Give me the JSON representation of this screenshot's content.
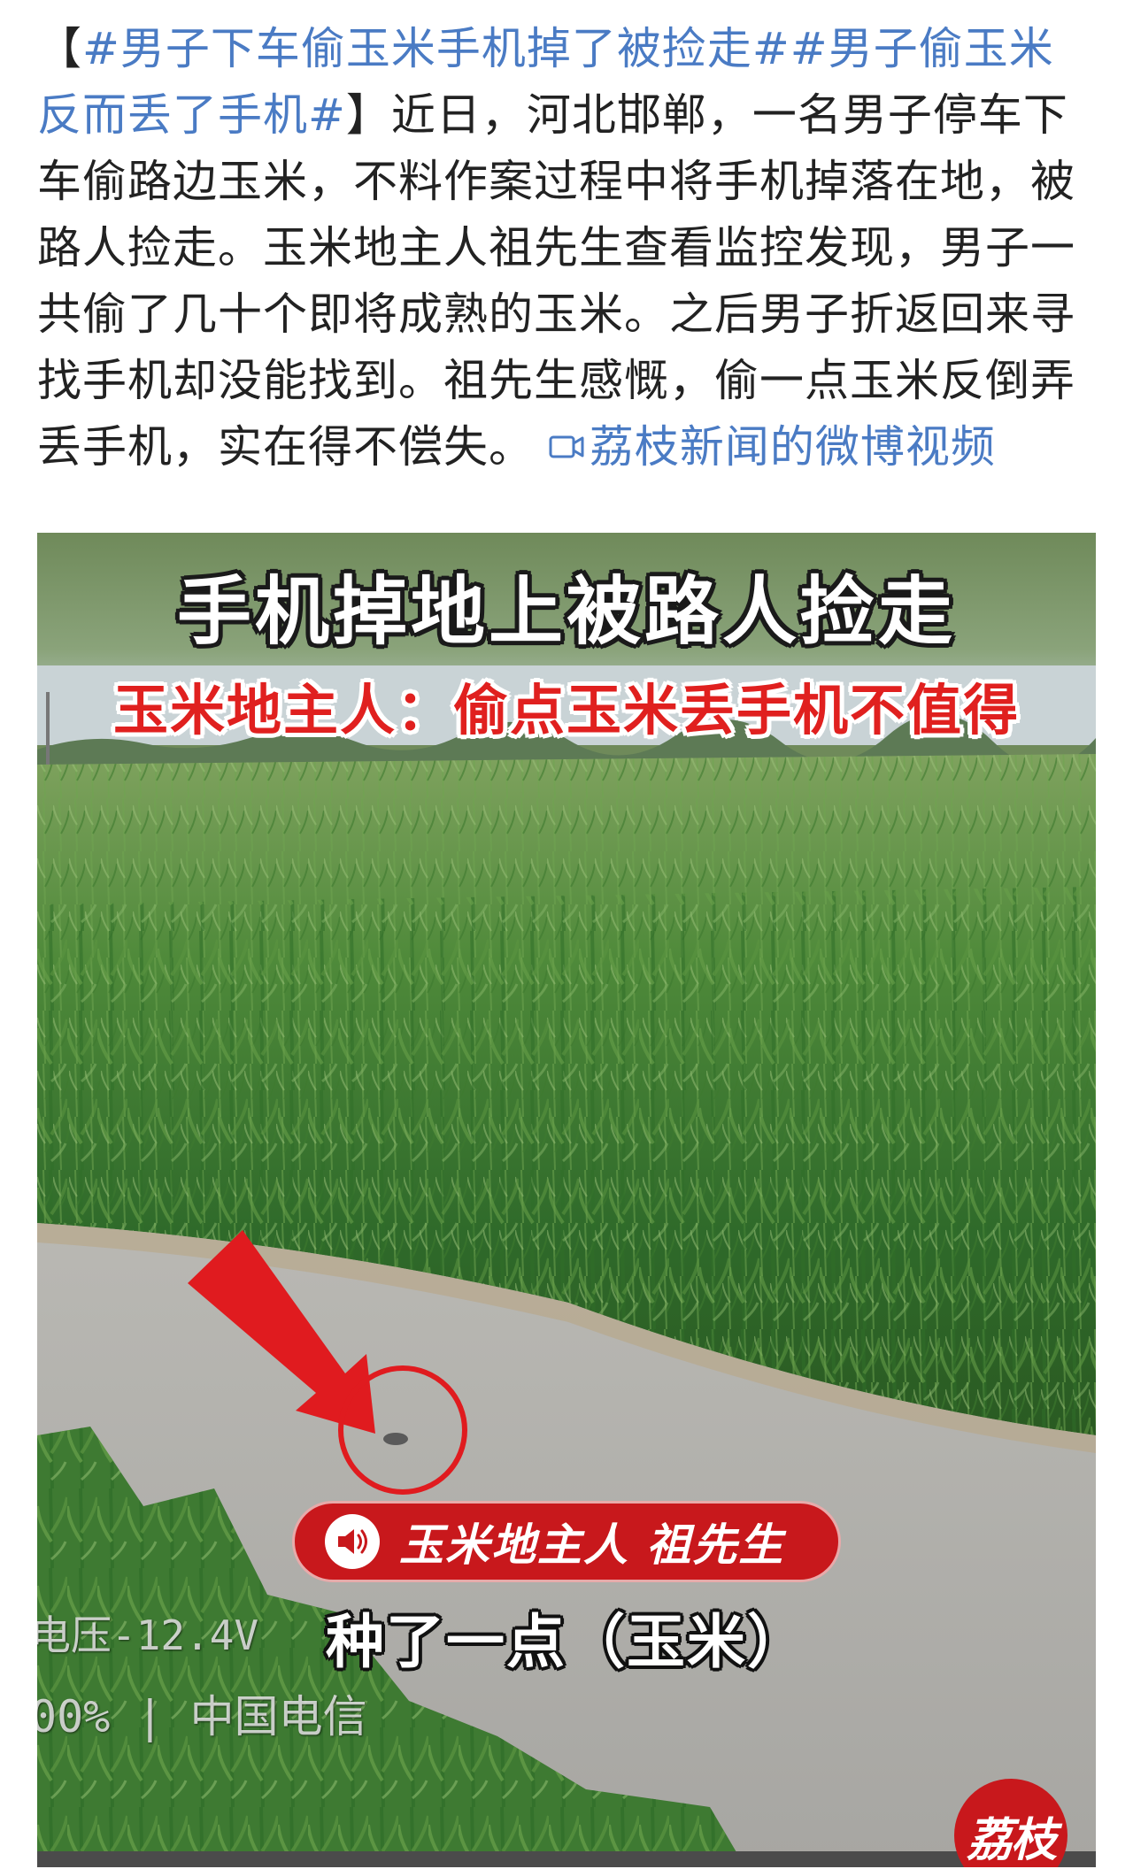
{
  "post": {
    "bracket_open": "【",
    "hashtag_1": "#男子下车偷玉米手机掉了被捡走#",
    "hashtag_2": "#男子偷玉米反而丢了手机#",
    "bracket_close": "】",
    "body": "近日，河北邯郸，一名男子停车下车偷路边玉米，不料作案过程中将手机掉落在地，被路人捡走。玉米地主人祖先生查看监控发现，男子一共偷了几十个即将成熟的玉米。之后男子折返回来寻找手机却没能找到。祖先生感慨，偷一点玉米反倒弄丢手机，实在得不偿失。",
    "video_link_label": "荔枝新闻的微博视频",
    "video_link_icon": "video-camera-icon",
    "link_color": "#4a7bc4"
  },
  "video": {
    "title": "手机掉地上被路人捡走",
    "subtitle": "玉米地主人：偷点玉米丢手机不值得",
    "speaker_label": "玉米地主人 祖先生",
    "caption": "种了一点（玉米）",
    "cam_voltage": "电压-12.4V",
    "cam_carrier": "00% | 中国电信",
    "watermark": "荔枝",
    "accent_red": "#c8181c",
    "arrow_icon": "red-arrow-icon",
    "circle_marker": "red-circle-marker"
  }
}
